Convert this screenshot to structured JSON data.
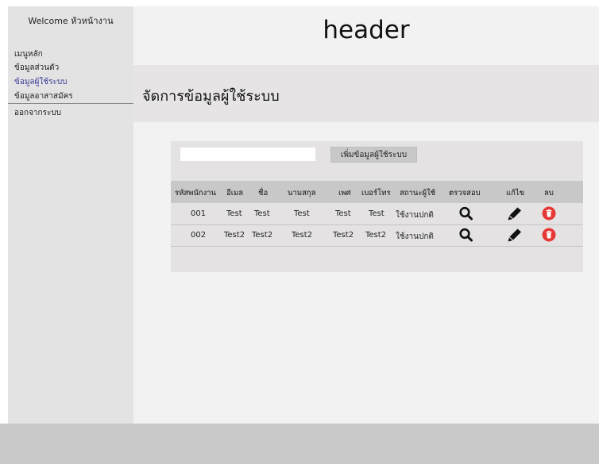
{
  "sidebar": {
    "welcome": "Welcome หัวหน้างาน",
    "items": [
      {
        "label": "เมนูหลัก"
      },
      {
        "label": "ข้อมูลส่วนตัว"
      },
      {
        "label": "ข้อมูลผู้ใช้ระบบ",
        "active": true
      },
      {
        "label": "ข้อมูลอาสาสมัคร"
      },
      {
        "label": "ออกจากระบบ"
      }
    ]
  },
  "header": {
    "title": "header"
  },
  "page": {
    "title": "จัดการข้อมูลผู้ใช้ระบบ"
  },
  "toolbar": {
    "search_value": "",
    "add_label": "เพิ่มข้อมูลผู้ใช้ระบบ"
  },
  "table": {
    "columns": [
      "รหัสพนักงาน",
      "อีเมล",
      "ชื่อ",
      "นามสกุล",
      "เพศ",
      "เบอร์โทร",
      "สถานะผู้ใช้",
      "ตรวจสอบ",
      "แก้ไข",
      "ลบ"
    ],
    "rows": [
      [
        "001",
        "Test",
        "Test",
        "Test",
        "Test",
        "Test",
        "ใช้งานปกติ"
      ],
      [
        "002",
        "Test2",
        "Test2",
        "Test2",
        "Test2",
        "Test2",
        "ใช้งานปกติ"
      ]
    ],
    "icons": {
      "view": "search-icon",
      "edit": "pencil-icon",
      "delete": "trash-icon"
    }
  },
  "colors": {
    "delete": "#e53935",
    "active_menu": "#3a3a9a"
  }
}
